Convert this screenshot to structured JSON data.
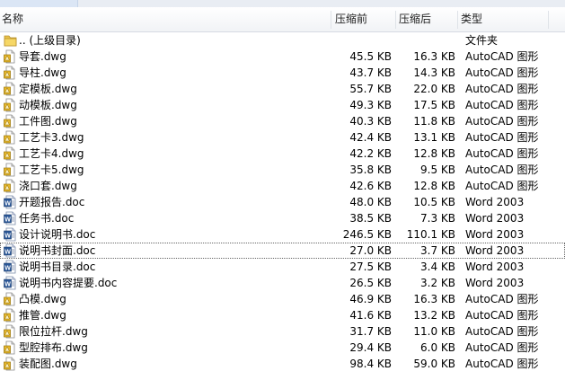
{
  "header": {
    "name": "名称",
    "compressed": "压缩前",
    "after": "压缩后",
    "type": "类型"
  },
  "rows": [
    {
      "name": "..  (上级目录)",
      "before": "",
      "after": "",
      "type": "文件夹",
      "icon": "folder-icon"
    },
    {
      "name": "导套.dwg",
      "before": "45.5 KB",
      "after": "16.3 KB",
      "type": "AutoCAD 图形",
      "icon": "dwg-file-icon"
    },
    {
      "name": "导柱.dwg",
      "before": "43.7 KB",
      "after": "14.3 KB",
      "type": "AutoCAD 图形",
      "icon": "dwg-file-icon"
    },
    {
      "name": "定模板.dwg",
      "before": "55.7 KB",
      "after": "22.0 KB",
      "type": "AutoCAD 图形",
      "icon": "dwg-file-icon"
    },
    {
      "name": "动模板.dwg",
      "before": "49.3 KB",
      "after": "17.5 KB",
      "type": "AutoCAD 图形",
      "icon": "dwg-file-icon"
    },
    {
      "name": "工件图.dwg",
      "before": "40.3 KB",
      "after": "11.8 KB",
      "type": "AutoCAD 图形",
      "icon": "dwg-file-icon"
    },
    {
      "name": "工艺卡3.dwg",
      "before": "42.4 KB",
      "after": "13.1 KB",
      "type": "AutoCAD 图形",
      "icon": "dwg-file-icon"
    },
    {
      "name": "工艺卡4.dwg",
      "before": "42.2 KB",
      "after": "12.8 KB",
      "type": "AutoCAD 图形",
      "icon": "dwg-file-icon"
    },
    {
      "name": "工艺卡5.dwg",
      "before": "35.8 KB",
      "after": "9.5 KB",
      "type": "AutoCAD 图形",
      "icon": "dwg-file-icon"
    },
    {
      "name": "浇口套.dwg",
      "before": "42.6 KB",
      "after": "12.8 KB",
      "type": "AutoCAD 图形",
      "icon": "dwg-file-icon"
    },
    {
      "name": "开题报告.doc",
      "before": "48.0 KB",
      "after": "10.5 KB",
      "type": "Word 2003",
      "icon": "word-file-icon"
    },
    {
      "name": "任务书.doc",
      "before": "38.5 KB",
      "after": "7.3 KB",
      "type": "Word 2003",
      "icon": "word-file-icon"
    },
    {
      "name": "设计说明书.doc",
      "before": "246.5 KB",
      "after": "110.1 KB",
      "type": "Word 2003",
      "icon": "word-file-icon"
    },
    {
      "name": "说明书封面.doc",
      "before": "27.0 KB",
      "after": "3.7 KB",
      "type": "Word 2003",
      "icon": "word-file-icon",
      "selected": true
    },
    {
      "name": "说明书目录.doc",
      "before": "27.5 KB",
      "after": "3.4 KB",
      "type": "Word 2003",
      "icon": "word-file-icon"
    },
    {
      "name": "说明书内容提要.doc",
      "before": "26.5 KB",
      "after": "3.2 KB",
      "type": "Word 2003",
      "icon": "word-file-icon"
    },
    {
      "name": "凸模.dwg",
      "before": "46.9 KB",
      "after": "16.3 KB",
      "type": "AutoCAD 图形",
      "icon": "dwg-file-icon"
    },
    {
      "name": "推管.dwg",
      "before": "41.6 KB",
      "after": "13.2 KB",
      "type": "AutoCAD 图形",
      "icon": "dwg-file-icon"
    },
    {
      "name": "限位拉杆.dwg",
      "before": "31.7 KB",
      "after": "11.0 KB",
      "type": "AutoCAD 图形",
      "icon": "dwg-file-icon"
    },
    {
      "name": "型腔排布.dwg",
      "before": "29.4 KB",
      "after": "6.0 KB",
      "type": "AutoCAD 图形",
      "icon": "dwg-file-icon"
    },
    {
      "name": "装配图.dwg",
      "before": "98.4 KB",
      "after": "59.0 KB",
      "type": "AutoCAD 图形",
      "icon": "dwg-file-icon"
    }
  ]
}
